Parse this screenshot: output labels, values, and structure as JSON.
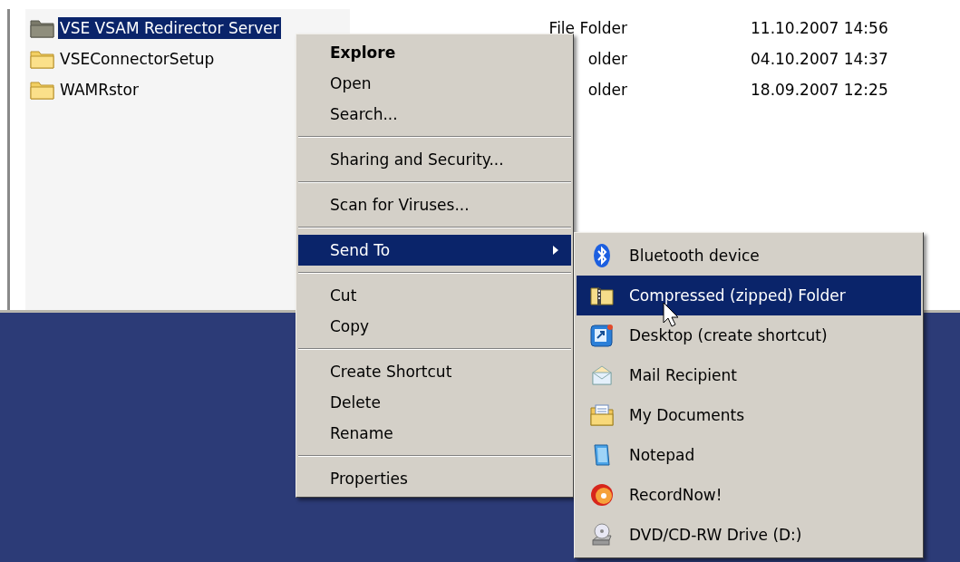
{
  "file_list": {
    "rows": [
      {
        "name": "VSE VSAM Redirector Server",
        "type": "File Folder",
        "modified": "11.10.2007 14:56",
        "selected": true
      },
      {
        "name": "VSEConnectorSetup",
        "type": "older",
        "modified": "04.10.2007 14:37",
        "selected": false
      },
      {
        "name": "WAMRstor",
        "type": "older",
        "modified": "18.09.2007 12:25",
        "selected": false
      }
    ]
  },
  "context_menu": {
    "groups": [
      [
        {
          "label": "Explore",
          "default": true,
          "submenu": false,
          "selected": false
        },
        {
          "label": "Open",
          "default": false,
          "submenu": false,
          "selected": false
        },
        {
          "label": "Search...",
          "default": false,
          "submenu": false,
          "selected": false
        }
      ],
      [
        {
          "label": "Sharing and Security...",
          "default": false,
          "submenu": false,
          "selected": false
        }
      ],
      [
        {
          "label": "Scan for Viruses...",
          "default": false,
          "submenu": false,
          "selected": false
        }
      ],
      [
        {
          "label": "Send To",
          "default": false,
          "submenu": true,
          "selected": true
        }
      ],
      [
        {
          "label": "Cut",
          "default": false,
          "submenu": false,
          "selected": false
        },
        {
          "label": "Copy",
          "default": false,
          "submenu": false,
          "selected": false
        }
      ],
      [
        {
          "label": "Create Shortcut",
          "default": false,
          "submenu": false,
          "selected": false
        },
        {
          "label": "Delete",
          "default": false,
          "submenu": false,
          "selected": false
        },
        {
          "label": "Rename",
          "default": false,
          "submenu": false,
          "selected": false
        }
      ],
      [
        {
          "label": "Properties",
          "default": false,
          "submenu": false,
          "selected": false
        }
      ]
    ]
  },
  "send_to_menu": {
    "items": [
      {
        "label": "Bluetooth device",
        "kind": "bluetooth",
        "selected": false
      },
      {
        "label": "Compressed (zipped) Folder",
        "kind": "zip",
        "selected": true
      },
      {
        "label": "Desktop (create shortcut)",
        "kind": "desktop",
        "selected": false
      },
      {
        "label": "Mail Recipient",
        "kind": "mail",
        "selected": false
      },
      {
        "label": "My Documents",
        "kind": "documents",
        "selected": false
      },
      {
        "label": "Notepad",
        "kind": "notepad",
        "selected": false
      },
      {
        "label": "RecordNow!",
        "kind": "record",
        "selected": false
      },
      {
        "label": "DVD/CD-RW Drive (D:)",
        "kind": "drive",
        "selected": false
      }
    ]
  }
}
